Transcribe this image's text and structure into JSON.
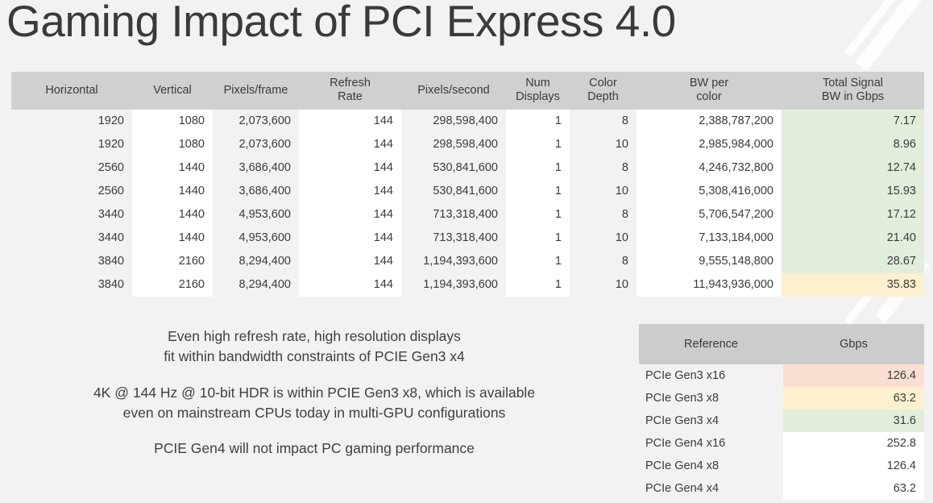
{
  "title": "Gaming Impact of PCI Express 4.0",
  "main_table": {
    "headers": [
      "Horizontal",
      "Vertical",
      "Pixels/frame",
      "Refresh\nRate",
      "Pixels/second",
      "Num\nDisplays",
      "Color\nDepth",
      "BW per\ncolor",
      "Total Signal\nBW in Gbps"
    ],
    "rows": [
      [
        "1920",
        "1080",
        "2,073,600",
        "144",
        "298,598,400",
        "1",
        "8",
        "2,388,787,200",
        "7.17"
      ],
      [
        "1920",
        "1080",
        "2,073,600",
        "144",
        "298,598,400",
        "1",
        "10",
        "2,985,984,000",
        "8.96"
      ],
      [
        "2560",
        "1440",
        "3,686,400",
        "144",
        "530,841,600",
        "1",
        "8",
        "4,246,732,800",
        "12.74"
      ],
      [
        "2560",
        "1440",
        "3,686,400",
        "144",
        "530,841,600",
        "1",
        "10",
        "5,308,416,000",
        "15.93"
      ],
      [
        "3440",
        "1440",
        "4,953,600",
        "144",
        "713,318,400",
        "1",
        "8",
        "5,706,547,200",
        "17.12"
      ],
      [
        "3440",
        "1440",
        "4,953,600",
        "144",
        "713,318,400",
        "1",
        "10",
        "7,133,184,000",
        "21.40"
      ],
      [
        "3840",
        "2160",
        "8,294,400",
        "144",
        "1,194,393,600",
        "1",
        "8",
        "9,555,148,800",
        "28.67"
      ],
      [
        "3840",
        "2160",
        "8,294,400",
        "144",
        "1,194,393,600",
        "1",
        "10",
        "11,943,936,000",
        "35.83"
      ]
    ],
    "total_bw_highlight": [
      "green",
      "green",
      "green",
      "green",
      "green",
      "green",
      "green",
      "cream"
    ]
  },
  "notes": [
    "Even high refresh rate, high resolution displays\nfit within bandwidth constraints of PCIE Gen3 x4",
    "4K @ 144 Hz @ 10-bit HDR is within PCIE Gen3 x8, which is available\neven on mainstream CPUs today in multi-GPU configurations",
    "PCIE Gen4 will not impact PC gaming performance"
  ],
  "ref_table": {
    "headers": [
      "Reference",
      "Gbps"
    ],
    "rows": [
      {
        "label": "PCIe Gen3 x16",
        "value": "126.4",
        "highlight": "peach"
      },
      {
        "label": "PCIe Gen3 x8",
        "value": "63.2",
        "highlight": "cream"
      },
      {
        "label": "PCIe Gen3 x4",
        "value": "31.6",
        "highlight": "green"
      },
      {
        "label": "PCIe Gen4 x16",
        "value": "252.8",
        "highlight": "plain"
      },
      {
        "label": "PCIe Gen4 x8",
        "value": "126.4",
        "highlight": "plain"
      },
      {
        "label": "PCIe Gen4 x4",
        "value": "63.2",
        "highlight": "plain"
      }
    ]
  },
  "colors": {
    "page_background": "#f2f2f2",
    "header_gray": "#d0d0d0",
    "ref_header_gray": "#cccccc",
    "shade_gray": "#f2f2f2",
    "green": "#e2eedc",
    "cream": "#fdf0cf",
    "peach": "#fadfd2",
    "text": "#3b3b3b"
  }
}
